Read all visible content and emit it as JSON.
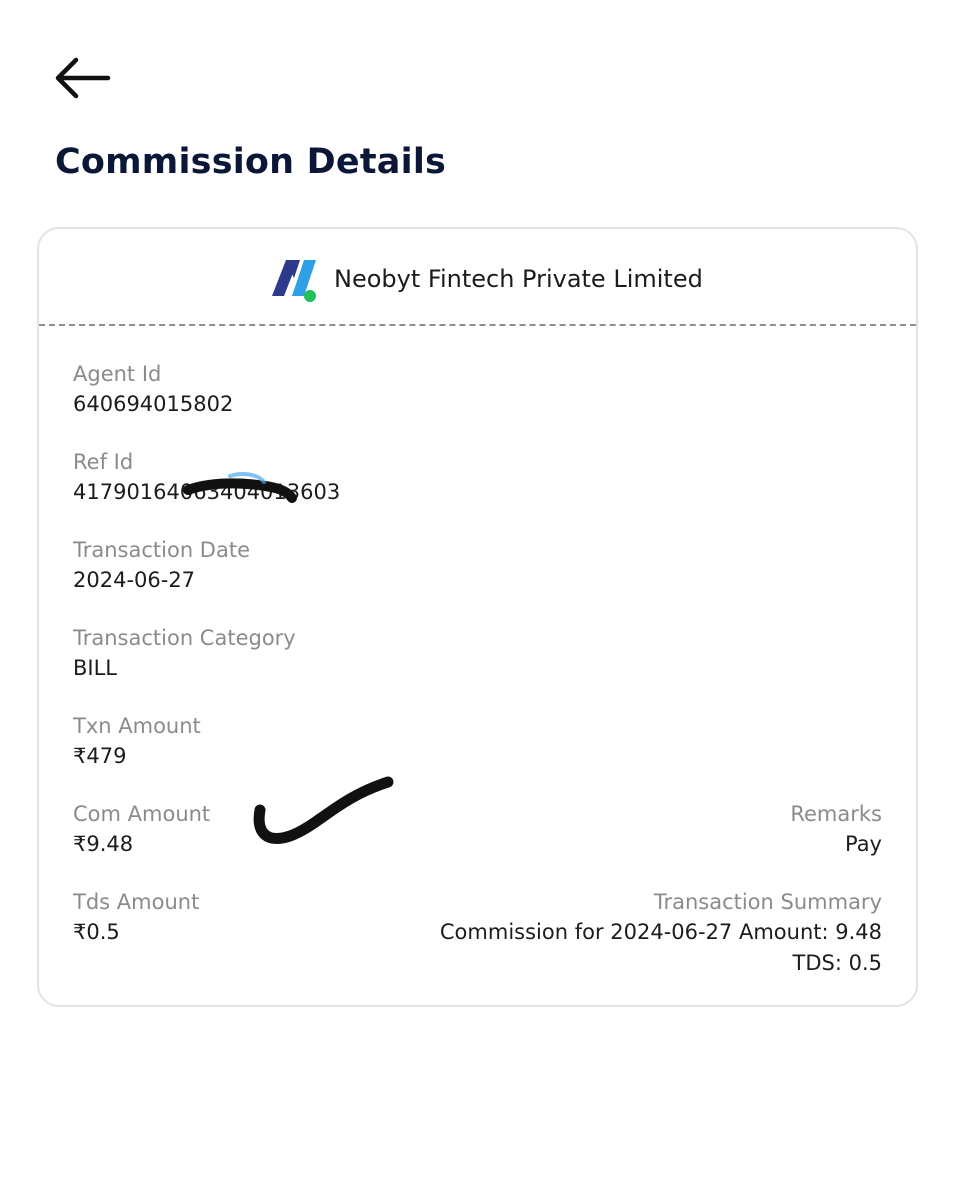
{
  "header": {
    "back_icon": "arrow-left-icon",
    "title": "Commission Details"
  },
  "card": {
    "brand": {
      "logo": "neobyt-logo",
      "name": "Neobyt Fintech Private Limited",
      "logo_colors": [
        "#2d3a8c",
        "#2f9fe8",
        "#1fbf5a"
      ]
    },
    "fields": {
      "agent_id": {
        "label": "Agent Id",
        "value": "640694015802"
      },
      "ref_id": {
        "label": "Ref Id",
        "value": "41790164063404013603"
      },
      "transaction_date": {
        "label": "Transaction Date",
        "value": "2024-06-27"
      },
      "transaction_category": {
        "label": "Transaction Category",
        "value": "BILL"
      },
      "txn_amount": {
        "label": "Txn Amount",
        "value": "₹479"
      },
      "com_amount": {
        "label": "Com Amount",
        "value": "₹9.48"
      },
      "tds_amount": {
        "label": "Tds Amount",
        "value": "₹0.5"
      },
      "remarks": {
        "label": "Remarks",
        "value": "Pay"
      },
      "transaction_summary": {
        "label": "Transaction Summary",
        "line1": "Commission for 2024-06-27 Amount: 9.48",
        "line2": "TDS: 0.5"
      }
    }
  },
  "colors": {
    "title": "#0b1736",
    "label": "#8b8b8b",
    "value": "#1c1c1c",
    "card_border": "#e3e3e3",
    "divider": "#8e8e8e",
    "scribble": "#111111"
  }
}
